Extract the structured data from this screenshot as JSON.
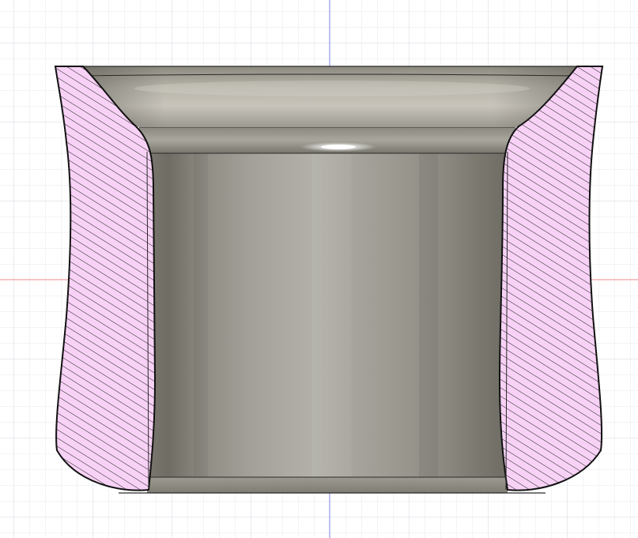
{
  "viewport": {
    "background": "#ffffff",
    "grid_minor_color": "#e6e9ee",
    "grid_major_color": "#d2d7df",
    "axis_vertical_color": "#7a86e8",
    "axis_horizontal_color": "#f08a8a"
  },
  "model": {
    "type": "section-view",
    "shape": "hollow flared sleeve",
    "section_fill_color": "#f8d2f6",
    "hatch_color": "#1a1a1a",
    "outline_color": "#111111",
    "surface_colors": {
      "light": "#c8c4bb",
      "mid": "#a3a096",
      "dark": "#6e6c63"
    }
  }
}
